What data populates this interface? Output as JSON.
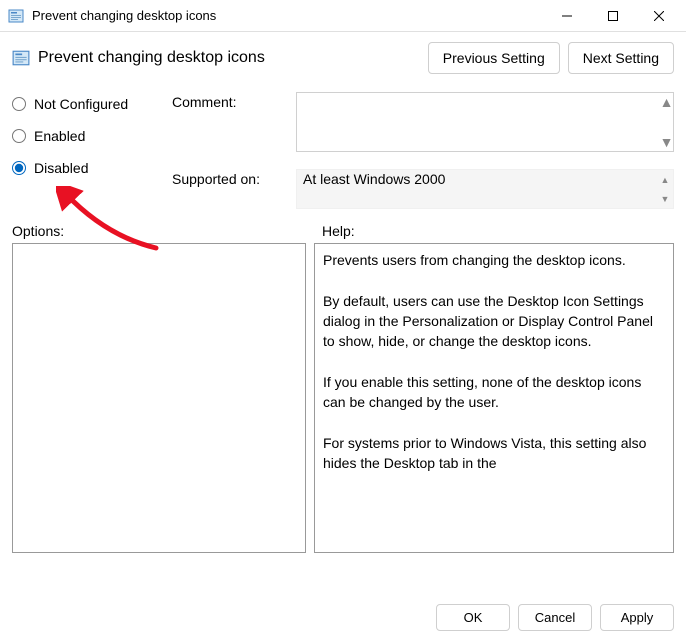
{
  "window": {
    "title": "Prevent changing desktop icons"
  },
  "header": {
    "policy_name": "Prevent changing desktop icons",
    "previous_btn": "Previous Setting",
    "next_btn": "Next Setting"
  },
  "state": {
    "not_configured": "Not Configured",
    "enabled": "Enabled",
    "disabled": "Disabled",
    "selected": "disabled"
  },
  "fields": {
    "comment_label": "Comment:",
    "comment_value": "",
    "supported_label": "Supported on:",
    "supported_value": "At least Windows 2000"
  },
  "sections": {
    "options_label": "Options:",
    "help_label": "Help:"
  },
  "help_text": "Prevents users from changing the desktop icons.\n\nBy default, users can use the Desktop Icon Settings dialog in the Personalization or Display Control Panel to show, hide, or change the desktop icons.\n\nIf you enable this setting, none of the desktop icons can be changed by the user.\n\nFor systems prior to Windows Vista, this setting also hides the Desktop tab in the",
  "footer": {
    "ok": "OK",
    "cancel": "Cancel",
    "apply": "Apply"
  }
}
